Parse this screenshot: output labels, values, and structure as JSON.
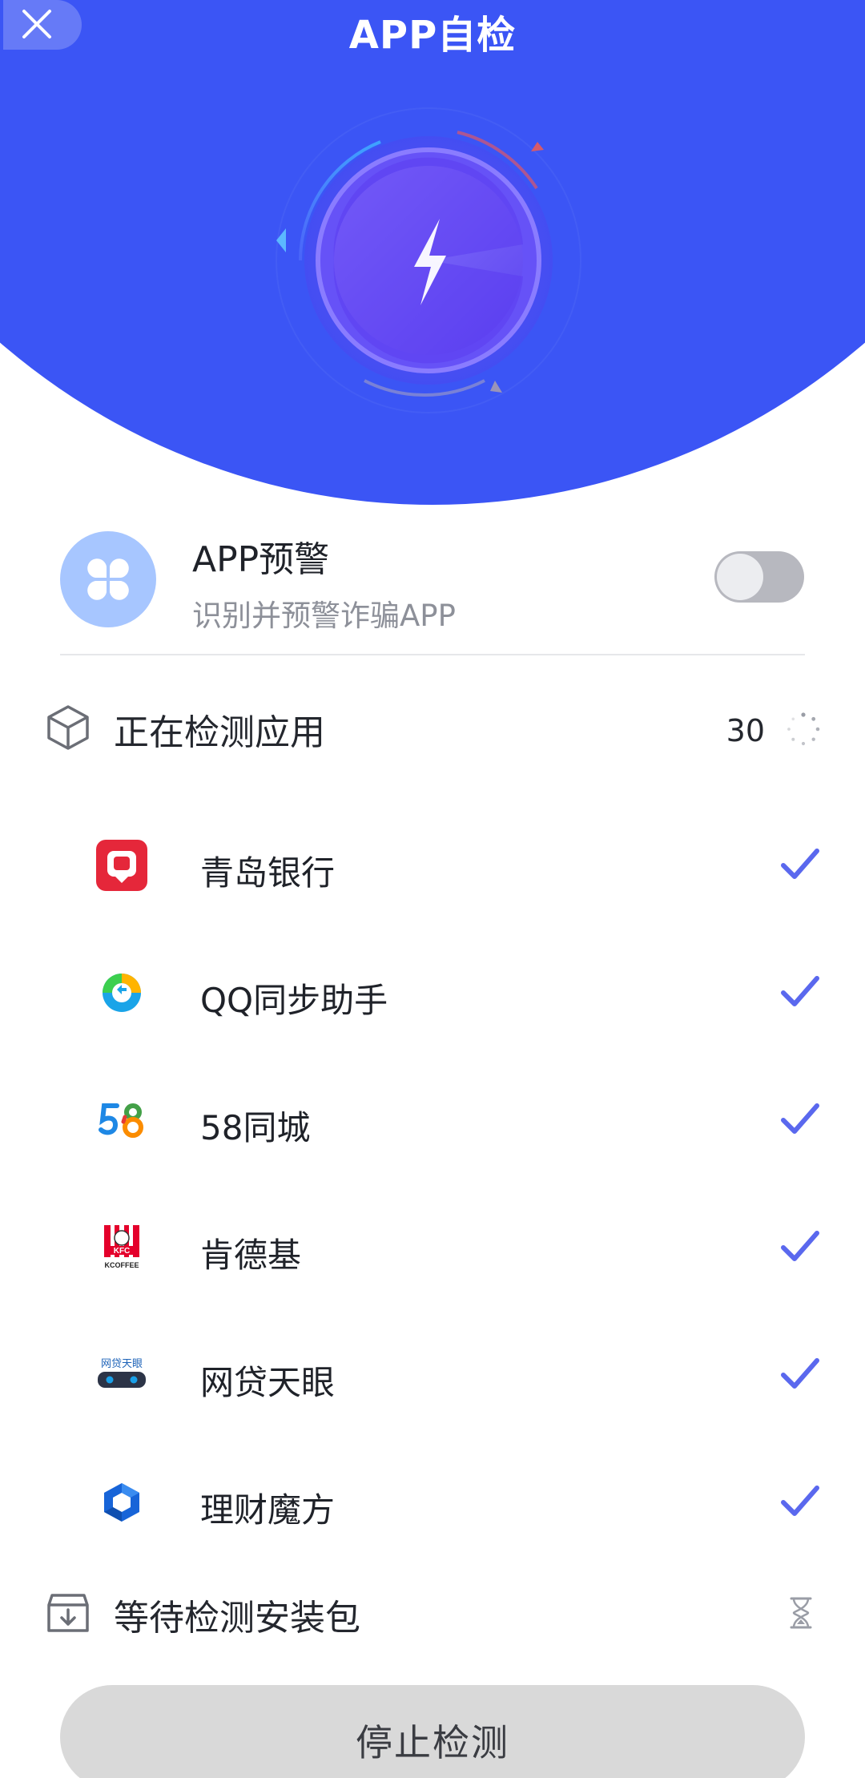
{
  "header": {
    "title": "APP自检",
    "close_icon": "close-icon",
    "bg_color": "#3b55f5"
  },
  "warning": {
    "title": "APP预警",
    "subtitle": "识别并预警诈骗APP",
    "toggle_on": false
  },
  "scanning": {
    "label": "正在检测应用",
    "count": "30"
  },
  "apps": [
    {
      "name": "青岛银行",
      "icon": "qingdao-bank-icon",
      "status": "checked"
    },
    {
      "name": "QQ同步助手",
      "icon": "qq-sync-icon",
      "status": "checked"
    },
    {
      "name": "58同城",
      "icon": "58-tongcheng-icon",
      "status": "checked"
    },
    {
      "name": "肯德基",
      "icon": "kfc-icon",
      "status": "checked"
    },
    {
      "name": "网贷天眼",
      "icon": "wangdai-tianyan-icon",
      "status": "checked"
    },
    {
      "name": "理财魔方",
      "icon": "licai-mofang-icon",
      "status": "checked"
    }
  ],
  "kfc_logo": {
    "brand": "KFC",
    "sub": "KCOFFEE"
  },
  "wangdai_logo": {
    "text": "网贷天眼"
  },
  "pending": {
    "label": "等待检测安装包"
  },
  "footer": {
    "stop_label": "停止检测"
  },
  "colors": {
    "accent": "#3b55f5",
    "check": "#5a68ee",
    "toggle_off": "#b7b8bf",
    "button_bg": "#d9d9d9"
  }
}
